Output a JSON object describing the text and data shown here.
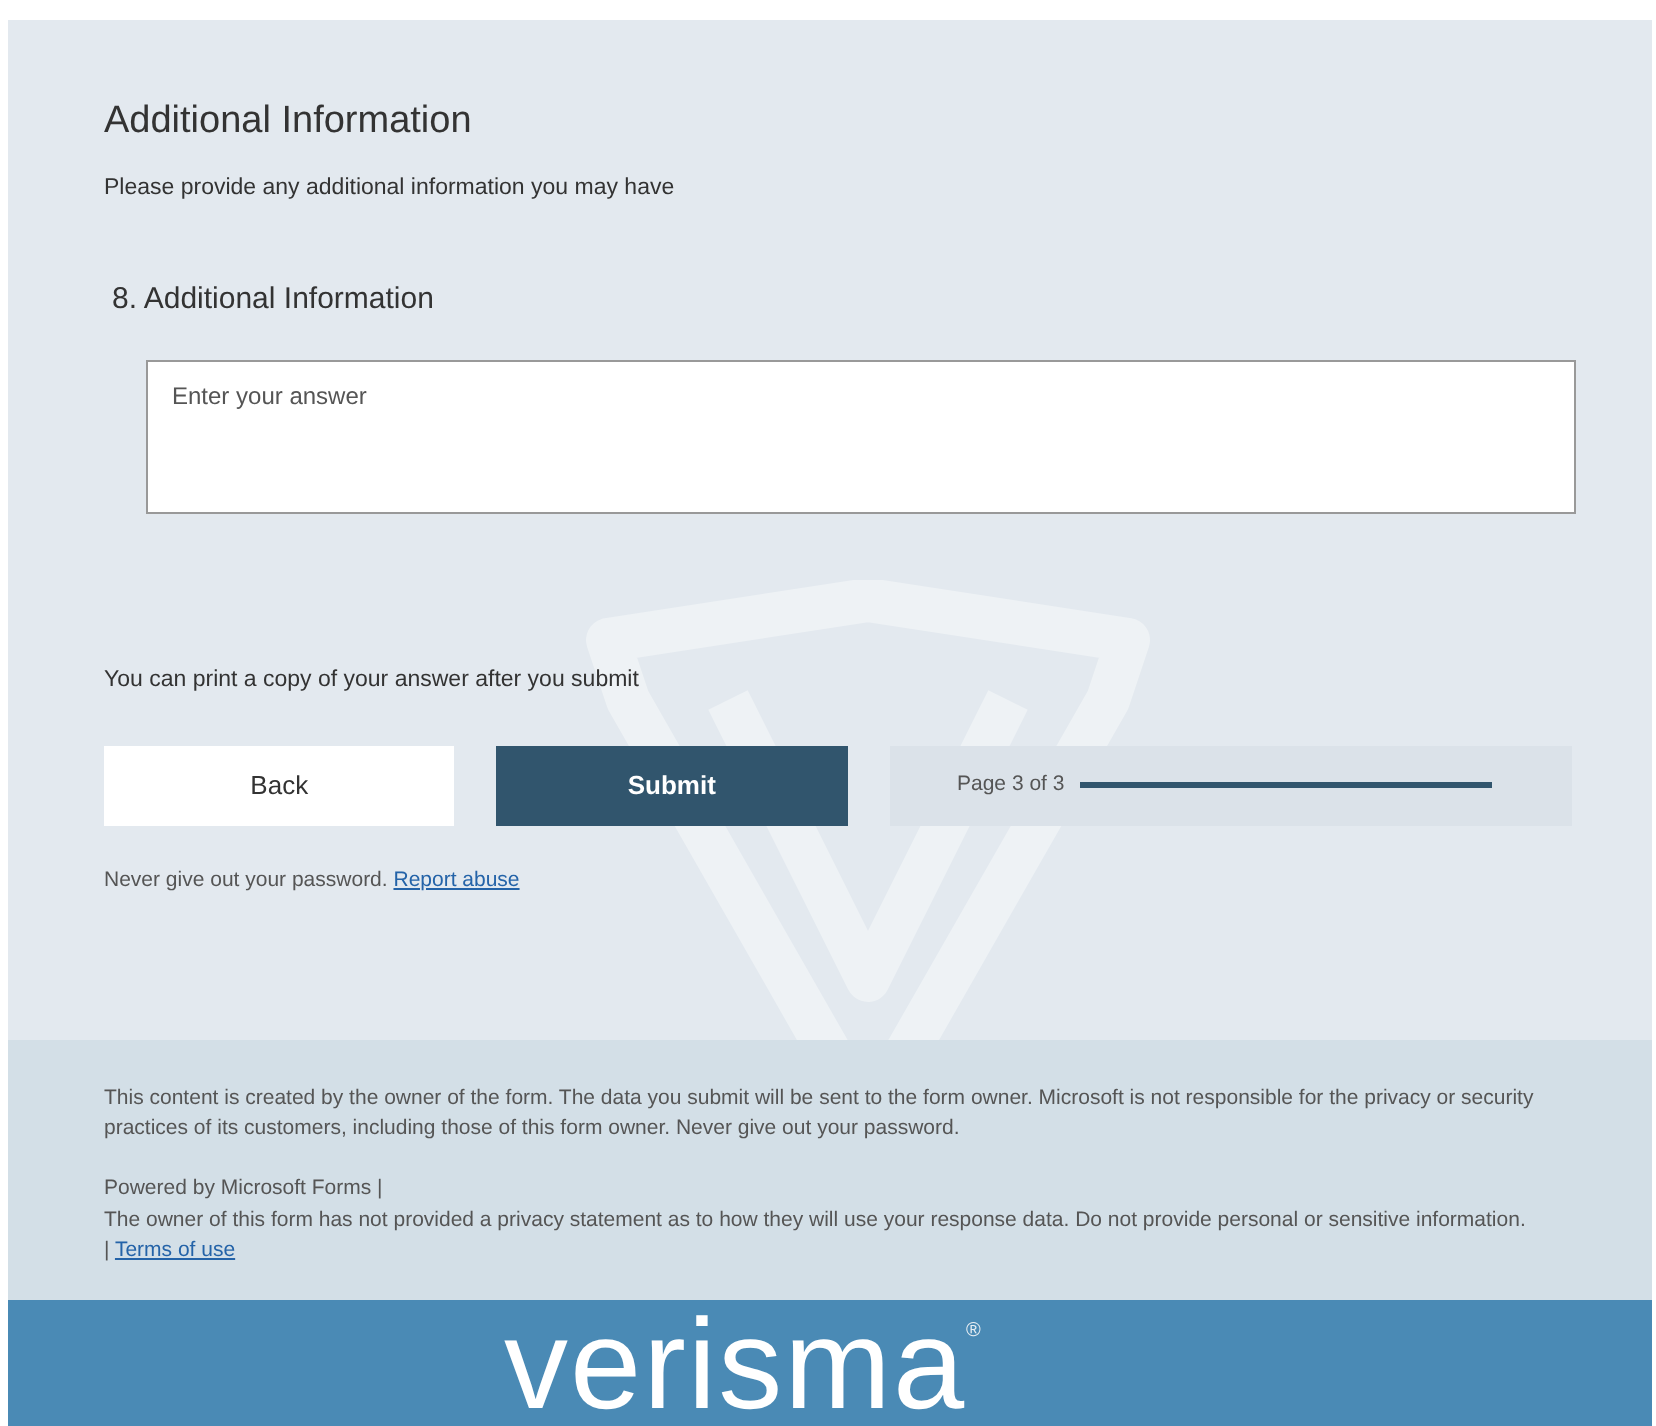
{
  "section": {
    "title": "Additional Information",
    "description": "Please provide any additional information you may have"
  },
  "question": {
    "number": "8.",
    "title": "Additional Information",
    "answer": {
      "placeholder": "Enter your answer"
    }
  },
  "print_note": "You can print a copy of your answer after you submit",
  "buttons": [
    {
      "kind": "secondary",
      "label": "Back"
    },
    {
      "kind": "primary",
      "label": "Submit"
    }
  ],
  "progress": {
    "label": "Page 3 of 3",
    "level": 1
  },
  "warning": {
    "text": "Never give out your password.",
    "link": "Report abuse"
  },
  "footer": {
    "disclaimer": "This content is created by the owner of the form. The data you submit will be sent to the form owner. Microsoft is not responsible for the privacy or security practices of its customers, including those of this form owner. Never give out your password.",
    "powered_by": "Powered by Microsoft Forms |",
    "privacy": "The owner of this form has not provided a privacy statement as to how they will use your response data. Do not provide personal or sensitive information.",
    "separator": "|",
    "terms_link": "Terms of use"
  },
  "brand": {
    "name": "verisma",
    "mark": "®"
  }
}
